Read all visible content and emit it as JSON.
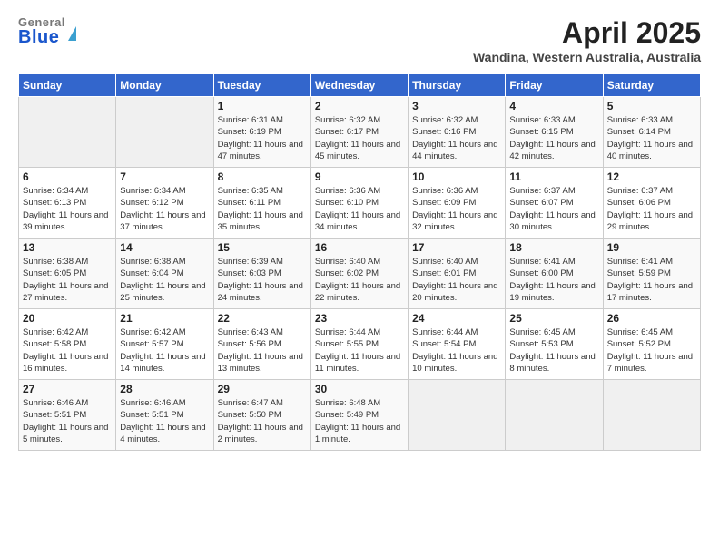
{
  "header": {
    "logo_top": "General",
    "logo_bottom": "Blue",
    "month_year": "April 2025",
    "location": "Wandina, Western Australia, Australia"
  },
  "days_of_week": [
    "Sunday",
    "Monday",
    "Tuesday",
    "Wednesday",
    "Thursday",
    "Friday",
    "Saturday"
  ],
  "weeks": [
    [
      {
        "day": "",
        "info": ""
      },
      {
        "day": "",
        "info": ""
      },
      {
        "day": "1",
        "sunrise": "Sunrise: 6:31 AM",
        "sunset": "Sunset: 6:19 PM",
        "daylight": "Daylight: 11 hours and 47 minutes."
      },
      {
        "day": "2",
        "sunrise": "Sunrise: 6:32 AM",
        "sunset": "Sunset: 6:17 PM",
        "daylight": "Daylight: 11 hours and 45 minutes."
      },
      {
        "day": "3",
        "sunrise": "Sunrise: 6:32 AM",
        "sunset": "Sunset: 6:16 PM",
        "daylight": "Daylight: 11 hours and 44 minutes."
      },
      {
        "day": "4",
        "sunrise": "Sunrise: 6:33 AM",
        "sunset": "Sunset: 6:15 PM",
        "daylight": "Daylight: 11 hours and 42 minutes."
      },
      {
        "day": "5",
        "sunrise": "Sunrise: 6:33 AM",
        "sunset": "Sunset: 6:14 PM",
        "daylight": "Daylight: 11 hours and 40 minutes."
      }
    ],
    [
      {
        "day": "6",
        "sunrise": "Sunrise: 6:34 AM",
        "sunset": "Sunset: 6:13 PM",
        "daylight": "Daylight: 11 hours and 39 minutes."
      },
      {
        "day": "7",
        "sunrise": "Sunrise: 6:34 AM",
        "sunset": "Sunset: 6:12 PM",
        "daylight": "Daylight: 11 hours and 37 minutes."
      },
      {
        "day": "8",
        "sunrise": "Sunrise: 6:35 AM",
        "sunset": "Sunset: 6:11 PM",
        "daylight": "Daylight: 11 hours and 35 minutes."
      },
      {
        "day": "9",
        "sunrise": "Sunrise: 6:36 AM",
        "sunset": "Sunset: 6:10 PM",
        "daylight": "Daylight: 11 hours and 34 minutes."
      },
      {
        "day": "10",
        "sunrise": "Sunrise: 6:36 AM",
        "sunset": "Sunset: 6:09 PM",
        "daylight": "Daylight: 11 hours and 32 minutes."
      },
      {
        "day": "11",
        "sunrise": "Sunrise: 6:37 AM",
        "sunset": "Sunset: 6:07 PM",
        "daylight": "Daylight: 11 hours and 30 minutes."
      },
      {
        "day": "12",
        "sunrise": "Sunrise: 6:37 AM",
        "sunset": "Sunset: 6:06 PM",
        "daylight": "Daylight: 11 hours and 29 minutes."
      }
    ],
    [
      {
        "day": "13",
        "sunrise": "Sunrise: 6:38 AM",
        "sunset": "Sunset: 6:05 PM",
        "daylight": "Daylight: 11 hours and 27 minutes."
      },
      {
        "day": "14",
        "sunrise": "Sunrise: 6:38 AM",
        "sunset": "Sunset: 6:04 PM",
        "daylight": "Daylight: 11 hours and 25 minutes."
      },
      {
        "day": "15",
        "sunrise": "Sunrise: 6:39 AM",
        "sunset": "Sunset: 6:03 PM",
        "daylight": "Daylight: 11 hours and 24 minutes."
      },
      {
        "day": "16",
        "sunrise": "Sunrise: 6:40 AM",
        "sunset": "Sunset: 6:02 PM",
        "daylight": "Daylight: 11 hours and 22 minutes."
      },
      {
        "day": "17",
        "sunrise": "Sunrise: 6:40 AM",
        "sunset": "Sunset: 6:01 PM",
        "daylight": "Daylight: 11 hours and 20 minutes."
      },
      {
        "day": "18",
        "sunrise": "Sunrise: 6:41 AM",
        "sunset": "Sunset: 6:00 PM",
        "daylight": "Daylight: 11 hours and 19 minutes."
      },
      {
        "day": "19",
        "sunrise": "Sunrise: 6:41 AM",
        "sunset": "Sunset: 5:59 PM",
        "daylight": "Daylight: 11 hours and 17 minutes."
      }
    ],
    [
      {
        "day": "20",
        "sunrise": "Sunrise: 6:42 AM",
        "sunset": "Sunset: 5:58 PM",
        "daylight": "Daylight: 11 hours and 16 minutes."
      },
      {
        "day": "21",
        "sunrise": "Sunrise: 6:42 AM",
        "sunset": "Sunset: 5:57 PM",
        "daylight": "Daylight: 11 hours and 14 minutes."
      },
      {
        "day": "22",
        "sunrise": "Sunrise: 6:43 AM",
        "sunset": "Sunset: 5:56 PM",
        "daylight": "Daylight: 11 hours and 13 minutes."
      },
      {
        "day": "23",
        "sunrise": "Sunrise: 6:44 AM",
        "sunset": "Sunset: 5:55 PM",
        "daylight": "Daylight: 11 hours and 11 minutes."
      },
      {
        "day": "24",
        "sunrise": "Sunrise: 6:44 AM",
        "sunset": "Sunset: 5:54 PM",
        "daylight": "Daylight: 11 hours and 10 minutes."
      },
      {
        "day": "25",
        "sunrise": "Sunrise: 6:45 AM",
        "sunset": "Sunset: 5:53 PM",
        "daylight": "Daylight: 11 hours and 8 minutes."
      },
      {
        "day": "26",
        "sunrise": "Sunrise: 6:45 AM",
        "sunset": "Sunset: 5:52 PM",
        "daylight": "Daylight: 11 hours and 7 minutes."
      }
    ],
    [
      {
        "day": "27",
        "sunrise": "Sunrise: 6:46 AM",
        "sunset": "Sunset: 5:51 PM",
        "daylight": "Daylight: 11 hours and 5 minutes."
      },
      {
        "day": "28",
        "sunrise": "Sunrise: 6:46 AM",
        "sunset": "Sunset: 5:51 PM",
        "daylight": "Daylight: 11 hours and 4 minutes."
      },
      {
        "day": "29",
        "sunrise": "Sunrise: 6:47 AM",
        "sunset": "Sunset: 5:50 PM",
        "daylight": "Daylight: 11 hours and 2 minutes."
      },
      {
        "day": "30",
        "sunrise": "Sunrise: 6:48 AM",
        "sunset": "Sunset: 5:49 PM",
        "daylight": "Daylight: 11 hours and 1 minute."
      },
      {
        "day": "",
        "info": ""
      },
      {
        "day": "",
        "info": ""
      },
      {
        "day": "",
        "info": ""
      }
    ]
  ]
}
